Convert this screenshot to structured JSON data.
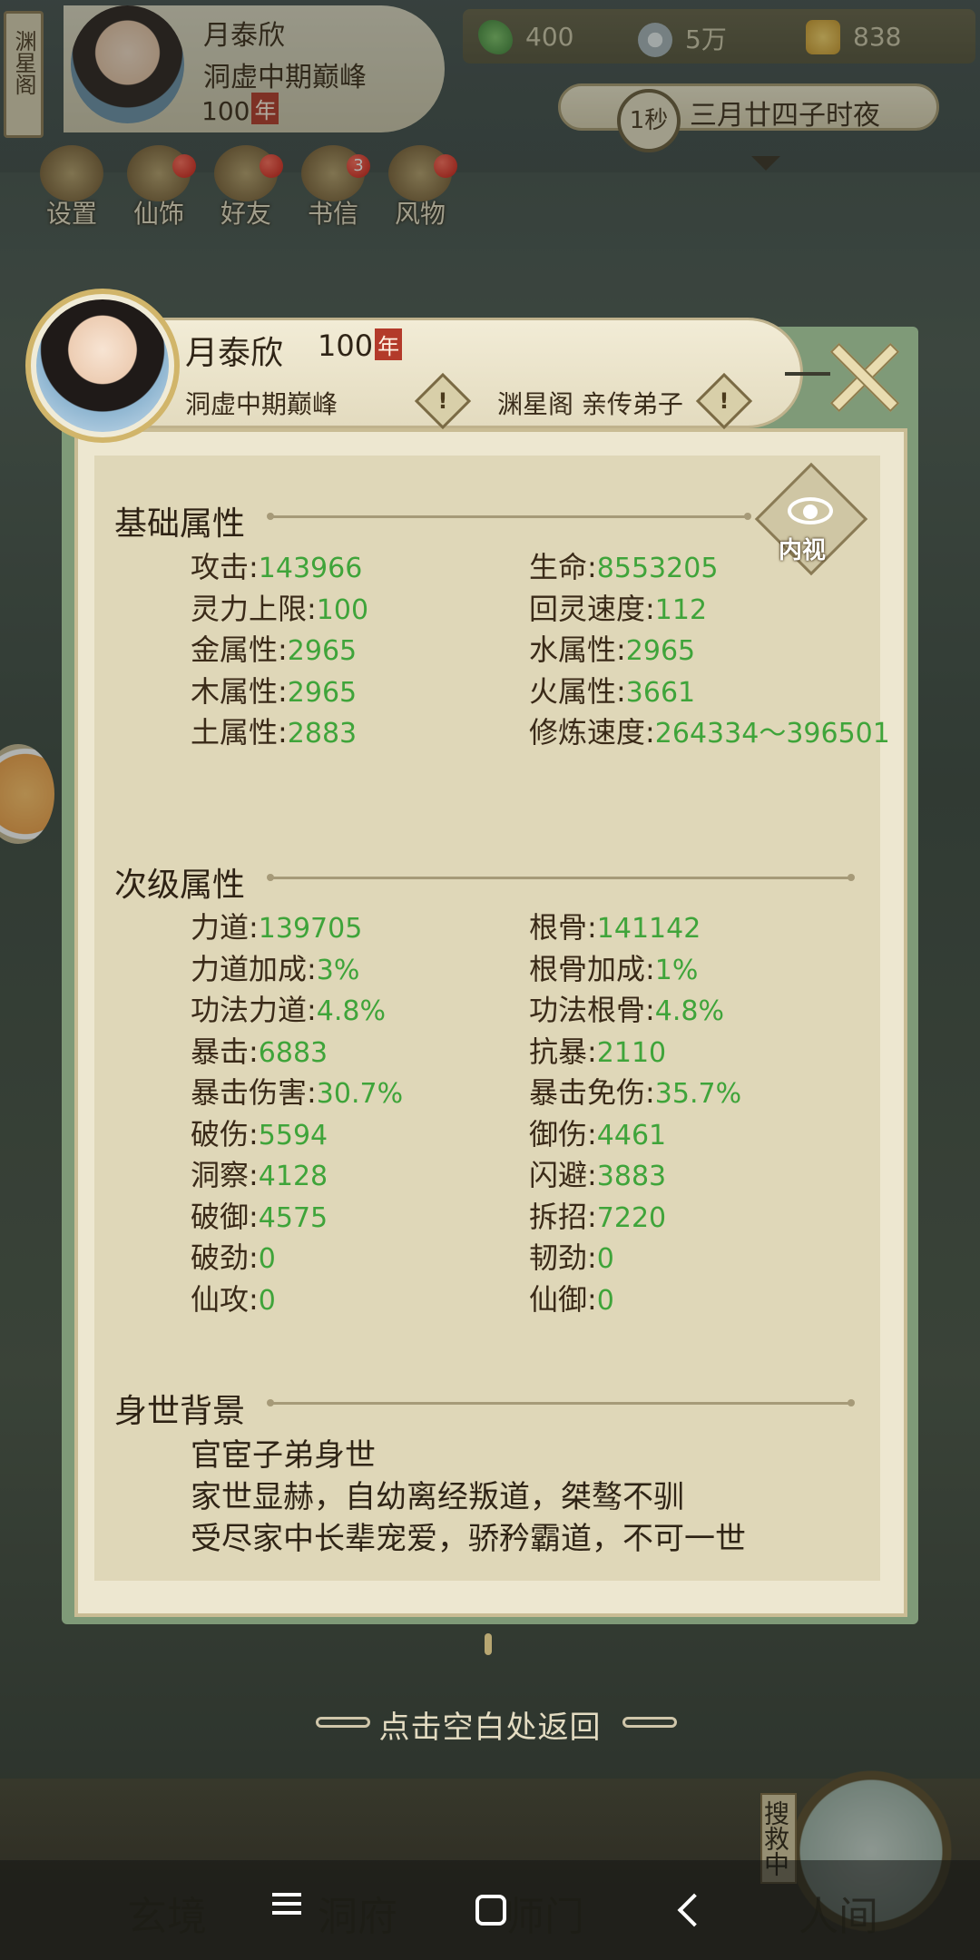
{
  "topbar": {
    "sect_tag": "渊星阁",
    "player_name": "月泰欣",
    "realm": "洞虚中期巅峰",
    "age_value": "100",
    "age_unit": "年",
    "resources": {
      "jade": "400",
      "coin": "5万",
      "gold": "838"
    },
    "time_badge": "1秒",
    "time_text": "三月廿四子时夜"
  },
  "menu": [
    {
      "label": "设置",
      "icon": "gear-icon"
    },
    {
      "label": "仙饰",
      "icon": "costume-icon",
      "badge": ""
    },
    {
      "label": "好友",
      "icon": "friends-icon",
      "badge": ""
    },
    {
      "label": "书信",
      "icon": "letter-icon",
      "badge": "3"
    },
    {
      "label": "风物",
      "icon": "collection-icon",
      "badge": ""
    }
  ],
  "panel": {
    "name": "月泰欣",
    "age_value": "100",
    "age_unit": "年",
    "realm": "洞虚中期巅峰",
    "sect": "渊星阁 亲传弟子",
    "warn_glyph": "!",
    "eye_label": "内视",
    "basic": {
      "title": "基础属性",
      "items": [
        {
          "label": "攻击",
          "value": "143966"
        },
        {
          "label": "生命",
          "value": "8553205"
        },
        {
          "label": "灵力上限",
          "value": "100"
        },
        {
          "label": "回灵速度",
          "value": "112"
        },
        {
          "label": "金属性",
          "value": "2965"
        },
        {
          "label": "水属性",
          "value": "2965"
        },
        {
          "label": "木属性",
          "value": "2965"
        },
        {
          "label": "火属性",
          "value": "3661"
        },
        {
          "label": "土属性",
          "value": "2883"
        },
        {
          "label": "修炼速度",
          "value": "264334～396501"
        }
      ]
    },
    "secondary": {
      "title": "次级属性",
      "items": [
        {
          "label": "力道",
          "value": "139705"
        },
        {
          "label": "根骨",
          "value": "141142"
        },
        {
          "label": "力道加成",
          "value": "3%"
        },
        {
          "label": "根骨加成",
          "value": "1%"
        },
        {
          "label": "功法力道",
          "value": "4.8%"
        },
        {
          "label": "功法根骨",
          "value": "4.8%"
        },
        {
          "label": "暴击",
          "value": "6883"
        },
        {
          "label": "抗暴",
          "value": "2110"
        },
        {
          "label": "暴击伤害",
          "value": "30.7%"
        },
        {
          "label": "暴击免伤",
          "value": "35.7%"
        },
        {
          "label": "破伤",
          "value": "5594"
        },
        {
          "label": "御伤",
          "value": "4461"
        },
        {
          "label": "洞察",
          "value": "4128"
        },
        {
          "label": "闪避",
          "value": "3883"
        },
        {
          "label": "破御",
          "value": "4575"
        },
        {
          "label": "拆招",
          "value": "7220"
        },
        {
          "label": "破劲",
          "value": "0"
        },
        {
          "label": "韧劲",
          "value": "0"
        },
        {
          "label": "仙攻",
          "value": "0"
        },
        {
          "label": "仙御",
          "value": "0"
        }
      ]
    },
    "background": {
      "title": "身世背景",
      "lines": [
        "官宦子弟身世",
        "家世显赫，自幼离经叛道，桀骜不驯",
        "受尽家中长辈宠爱，骄矜霸道，不可一世"
      ]
    }
  },
  "hint": "点击空白处返回",
  "bottom_nav": [
    {
      "label": "玄境"
    },
    {
      "label": "洞府"
    },
    {
      "label": "师门"
    },
    {
      "label": "人间"
    }
  ],
  "bottom_nav_vertical": "搜救中",
  "colors": {
    "value_green": "#3fa43a",
    "panel_frame": "#7f9a78",
    "panel_paper": "#dfd7b8",
    "badge_red": "#c7170f"
  }
}
